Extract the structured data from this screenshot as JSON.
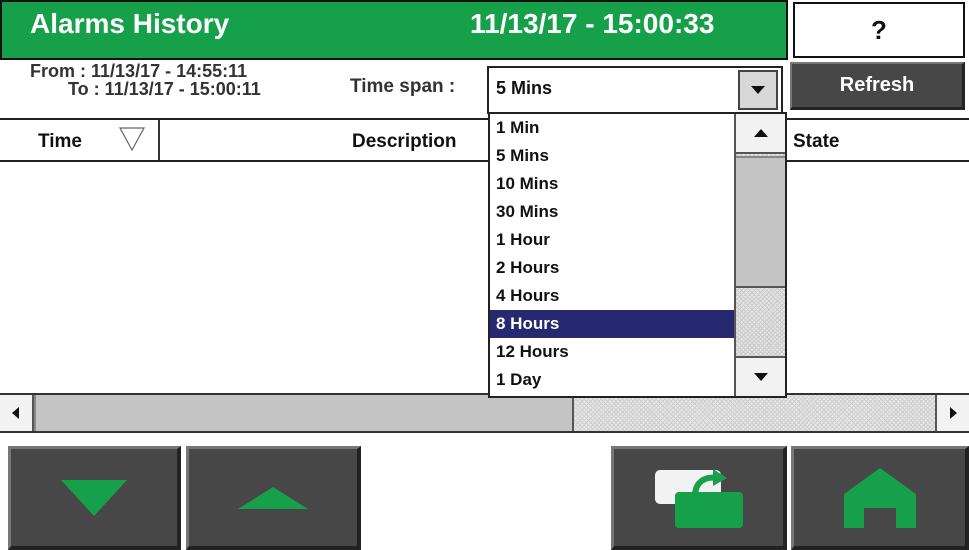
{
  "header": {
    "title": "Alarms History",
    "datetime": "11/13/17 - 15:00:33",
    "help_label": "?"
  },
  "filter": {
    "from_label": "From :",
    "from_value": "11/13/17 - 14:55:11",
    "to_label": "To :",
    "to_value": "11/13/17 - 15:00:11",
    "time_span_label": "Time span :",
    "time_span_value": "5 Mins",
    "refresh_label": "Refresh"
  },
  "table": {
    "columns": [
      "Time",
      "Description",
      "State"
    ],
    "sort_icon": "sort-descending-icon",
    "rows": []
  },
  "dropdown": {
    "options": [
      "1 Min",
      "5 Mins",
      "10 Mins",
      "30 Mins",
      "1 Hour",
      "2 Hours",
      "4 Hours",
      "8 Hours",
      "12 Hours",
      "1 Day"
    ],
    "highlighted": "8 Hours"
  },
  "toolbar": {
    "icons": [
      "arrow-down-icon",
      "arrow-up-icon",
      "swap-screen-icon",
      "home-icon"
    ]
  },
  "colors": {
    "accent_green": "#17a04a",
    "button_gray": "#474747",
    "highlight_blue": "#262870"
  }
}
